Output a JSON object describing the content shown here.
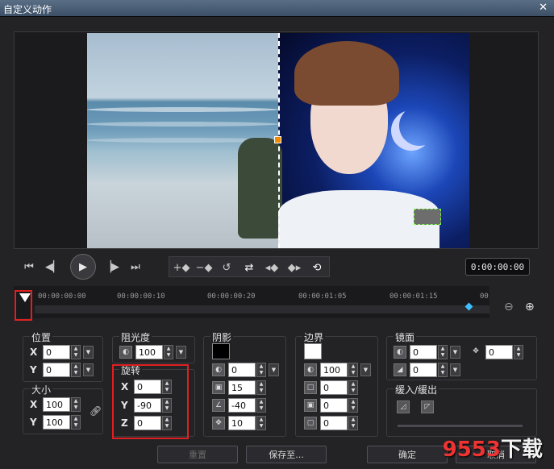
{
  "window": {
    "title": "自定义动作",
    "close_glyph": "✕"
  },
  "player": {
    "timecode": "0:00:00:00",
    "transport": [
      "home-icon",
      "prev-frame-icon",
      "play-icon",
      "next-frame-icon",
      "end-icon"
    ],
    "keyframe_tools": [
      "add-keyframe-icon",
      "remove-keyframe-icon",
      "reverse-icon",
      "swap-icon",
      "move-left-icon",
      "move-right-icon",
      "reset-icon"
    ]
  },
  "timeline": {
    "ticks": [
      "00:00:00:00",
      "00:00:00:10",
      "00:00:00:20",
      "00:00:01:05",
      "00:00:01:15",
      "00"
    ]
  },
  "panels": {
    "position": {
      "title": "位置",
      "x_label": "X",
      "x": "0",
      "y_label": "Y",
      "y": "0"
    },
    "size": {
      "title": "大小",
      "x_label": "X",
      "x": "100",
      "y_label": "Y",
      "y": "100"
    },
    "opacity": {
      "title": "阻光度",
      "value": "100"
    },
    "rotation": {
      "title": "旋转",
      "x_label": "X",
      "x": "0",
      "y_label": "Y",
      "y": "-90",
      "z_label": "Z",
      "z": "0"
    },
    "shadow": {
      "title": "阴影",
      "color": "#000000",
      "v1": "0",
      "v2": "15",
      "v3": "-40",
      "v4": "10"
    },
    "border": {
      "title": "边界",
      "color": "#ffffff",
      "v1": "100",
      "v2": "0",
      "v3": "0",
      "v4": "0"
    },
    "mirror": {
      "title": "镜面",
      "v1": "0",
      "v2": "0",
      "v3": "0"
    },
    "fade": {
      "title": "缓入/缓出"
    }
  },
  "buttons": {
    "reset": "重置",
    "save_to": "保存至...",
    "ok": "确定",
    "cancel": "取消"
  },
  "watermark": {
    "num": "9553",
    "suffix": "下载"
  }
}
